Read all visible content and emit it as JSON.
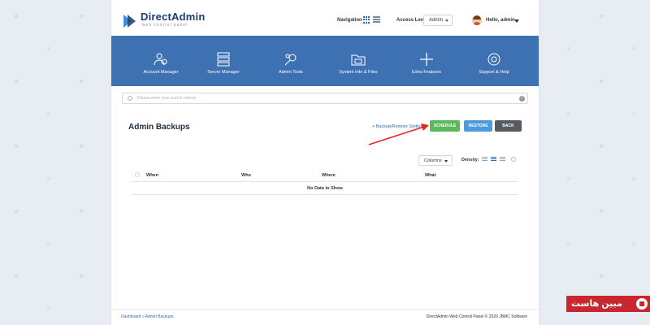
{
  "header": {
    "logo_title": "DirectAdmin",
    "logo_subtitle": "web control panel",
    "navigation_label": "Navigation",
    "access_level_label": "Access Level",
    "access_level_value": "Admin",
    "greeting": "Hello, admin"
  },
  "menu": [
    {
      "label": "Account Manager",
      "icon": "users-icon"
    },
    {
      "label": "Server Manager",
      "icon": "server-icon"
    },
    {
      "label": "Admin Tools",
      "icon": "tools-icon"
    },
    {
      "label": "System Info & Files",
      "icon": "folder-icon"
    },
    {
      "label": "Extra Features",
      "icon": "plus-icon"
    },
    {
      "label": "Support & Help",
      "icon": "lifebuoy-icon"
    }
  ],
  "search": {
    "placeholder": "Please enter your search criteria"
  },
  "page": {
    "title": "Admin Backups",
    "backup_settings_link": "+ Backup/Restore Settings",
    "schedule_label": "SCHEDULE",
    "restore_label": "RESTORE",
    "back_label": "BACK"
  },
  "table": {
    "columns_button": "Columns",
    "density_label": "Density:",
    "headers": [
      "When",
      "Who",
      "Where",
      "What"
    ],
    "empty_message": "No Data to Show"
  },
  "footer": {
    "breadcrumb": "Dashboard » Admin Backups",
    "copyright": "DirectAdmin Web Control Panel © 2020 JBMC Software"
  },
  "watermark": {
    "text": "مبین هاست"
  },
  "colors": {
    "menu_bg": "#3e71b2",
    "schedule": "#5cb85c",
    "restore": "#4a9be0",
    "back": "#555a60",
    "arrow": "#e52521"
  }
}
